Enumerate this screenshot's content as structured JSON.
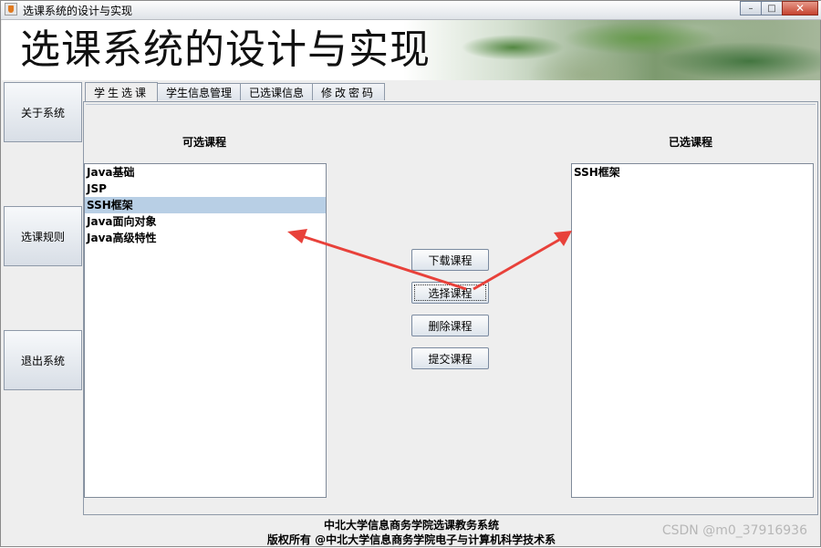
{
  "window": {
    "title": "选课系统的设计与实现",
    "buttons": {
      "minimize": "–",
      "maximize": "□",
      "close": "✕"
    }
  },
  "banner": {
    "title": "选课系统的设计与实现"
  },
  "sidebar": {
    "items": [
      {
        "label": "关于系统"
      },
      {
        "label": "选课规则"
      },
      {
        "label": "退出系统"
      }
    ]
  },
  "tabs": [
    {
      "label": "学生选课",
      "active": true
    },
    {
      "label": "学生信息管理"
    },
    {
      "label": "已选课信息"
    },
    {
      "label": "修改密码"
    }
  ],
  "available": {
    "label": "可选课程",
    "items": [
      "Java基础",
      "JSP",
      "SSH框架",
      "Java面向对象",
      "Java高级特性"
    ],
    "selected_index": 2
  },
  "chosen": {
    "label": "已选课程",
    "items": [
      "SSH框架"
    ]
  },
  "actions": {
    "download": "下载课程",
    "select": "选择课程",
    "delete": "删除课程",
    "submit": "提交课程"
  },
  "footer": {
    "line1": "中北大学信息商务学院选课教务系统",
    "line2": "版权所有 @中北大学信息商务学院电子与计算机科学技术系"
  },
  "watermark": "CSDN @m0_37916936",
  "colors": {
    "selection": "#b8cfe5",
    "annotation_arrow": "#e8413a"
  }
}
